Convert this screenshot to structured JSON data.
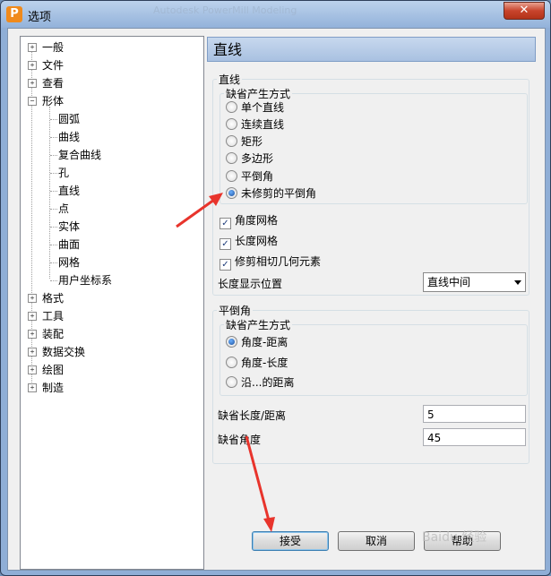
{
  "window": {
    "title": "选项",
    "app_icon": "P",
    "close_glyph": "✕",
    "ghost_title": "Autodesk PowerMill Modeling"
  },
  "tree": {
    "items": [
      {
        "label": "一般",
        "expander": "+"
      },
      {
        "label": "文件",
        "expander": "+"
      },
      {
        "label": "查看",
        "expander": "+"
      },
      {
        "label": "形体",
        "expander": "−"
      },
      {
        "label": "圆弧"
      },
      {
        "label": "曲线"
      },
      {
        "label": "复合曲线"
      },
      {
        "label": "孔"
      },
      {
        "label": "直线"
      },
      {
        "label": "点"
      },
      {
        "label": "实体"
      },
      {
        "label": "曲面"
      },
      {
        "label": "网格"
      },
      {
        "label": "用户坐标系"
      },
      {
        "label": "格式",
        "expander": "+"
      },
      {
        "label": "工具",
        "expander": "+"
      },
      {
        "label": "装配",
        "expander": "+"
      },
      {
        "label": "数据交换",
        "expander": "+"
      },
      {
        "label": "绘图",
        "expander": "+"
      },
      {
        "label": "制造",
        "expander": "+"
      }
    ]
  },
  "panel": {
    "header": "直线",
    "line_group": {
      "title": "直线",
      "default_mode_title": "缺省产生方式",
      "options": [
        "单个直线",
        "连续直线",
        "矩形",
        "多边形",
        "平倒角",
        "未修剪的平倒角"
      ],
      "selected_index": 5
    },
    "checkboxes": [
      {
        "label": "角度网格",
        "checked": true
      },
      {
        "label": "长度网格",
        "checked": true
      },
      {
        "label": "修剪相切几何元素",
        "checked": true
      }
    ],
    "length_display": {
      "label": "长度显示位置",
      "value": "直线中间"
    },
    "chamfer_group": {
      "title": "平倒角",
      "default_mode_title": "缺省产生方式",
      "options": [
        "角度-距离",
        "角度-长度",
        "沿...的距离"
      ],
      "selected_index": 0
    },
    "default_length": {
      "label": "缺省长度/距离",
      "value": "5"
    },
    "default_angle": {
      "label": "缺省角度",
      "value": "45"
    }
  },
  "buttons": {
    "accept": "接受",
    "cancel": "取消",
    "help": "帮助"
  },
  "watermark": "Baidu 经验"
}
